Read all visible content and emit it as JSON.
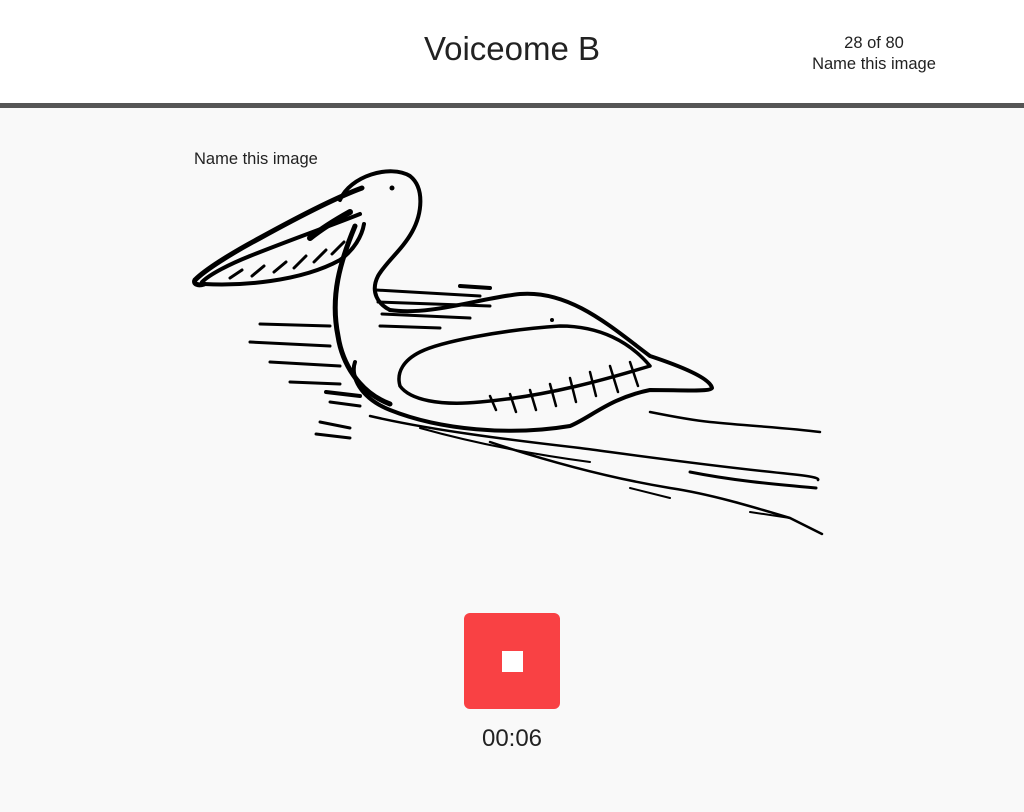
{
  "header": {
    "title": "Voiceome B",
    "progress": "28 of 80",
    "task_name": "Name this image"
  },
  "task": {
    "prompt": "Name this image",
    "image_icon": "pelican-drawing-icon"
  },
  "recorder": {
    "icon": "stop-icon",
    "button_color": "#f94144",
    "elapsed": "00:06"
  }
}
